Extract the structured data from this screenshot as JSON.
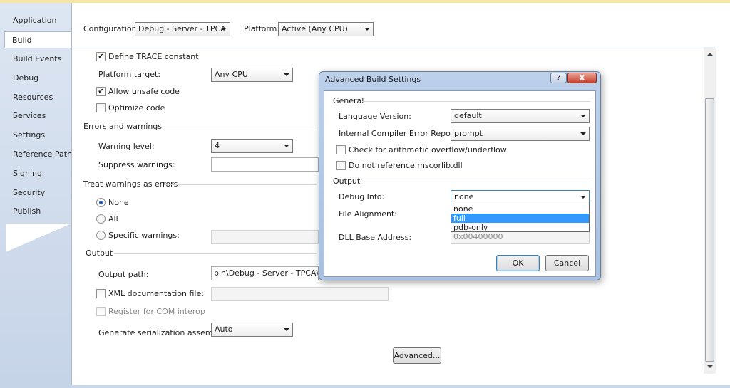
{
  "sidebar": {
    "tabs": [
      "Application",
      "Build",
      "Build Events",
      "Debug",
      "Resources",
      "Services",
      "Settings",
      "Reference Paths",
      "Signing",
      "Security",
      "Publish"
    ],
    "active_tab": "Build"
  },
  "header": {
    "configuration_label": "Configuration:",
    "configuration_value": "Debug - Server - TPCA",
    "platform_label": "Platform:",
    "platform_value": "Active (Any CPU)"
  },
  "general": {
    "define_trace_label": "Define TRACE constant",
    "define_trace_checked": true,
    "platform_target_label": "Platform target:",
    "platform_target_value": "Any CPU",
    "allow_unsafe_label": "Allow unsafe code",
    "allow_unsafe_checked": true,
    "optimize_label": "Optimize code",
    "optimize_checked": false
  },
  "errors": {
    "group_label": "Errors and warnings",
    "warning_level_label": "Warning level:",
    "warning_level_value": "4",
    "suppress_label": "Suppress warnings:",
    "suppress_value": ""
  },
  "treat_warnings": {
    "group_label": "Treat warnings as errors",
    "none_label": "None",
    "all_label": "All",
    "specific_label": "Specific warnings:",
    "selected": "None"
  },
  "output": {
    "group_label": "Output",
    "output_path_label": "Output path:",
    "output_path_value": "bin\\Debug - Server - TPCA\\",
    "xml_doc_label": "XML documentation file:",
    "xml_doc_checked": false,
    "register_com_label": "Register for COM interop",
    "serialization_label": "Generate serialization assembly:",
    "serialization_value": "Auto",
    "advanced_button": "Advanced..."
  },
  "dialog": {
    "title": "Advanced Build Settings",
    "help_glyph": "?",
    "close_glyph": "X",
    "general_group": "General",
    "language_version_label": "Language Version:",
    "language_version_value": "default",
    "ice_reporting_label": "Internal Compiler Error Reporting:",
    "ice_reporting_value": "prompt",
    "overflow_label": "Check for arithmetic overflow/underflow",
    "overflow_checked": false,
    "no_mscorlib_label": "Do not reference mscorlib.dll",
    "no_mscorlib_checked": false,
    "output_group": "Output",
    "debug_info_label": "Debug Info:",
    "debug_info_value": "none",
    "debug_info_options": [
      "none",
      "full",
      "pdb-only"
    ],
    "debug_info_highlighted": "full",
    "file_alignment_label": "File Alignment:",
    "dll_base_label": "DLL Base Address:",
    "dll_base_value": "0x00400000",
    "ok_button": "OK",
    "cancel_button": "Cancel"
  },
  "icons": {
    "check": "check-icon",
    "dropdown_arrow": "chevron-down-icon",
    "scroll_up": "scroll-up-icon",
    "scroll_down": "scroll-down-icon"
  },
  "colors": {
    "selection": "#3399ff",
    "panel_background": "#c9d7ea",
    "dialog_frame": "#a9c1e2",
    "close_button": "#c6402c"
  }
}
